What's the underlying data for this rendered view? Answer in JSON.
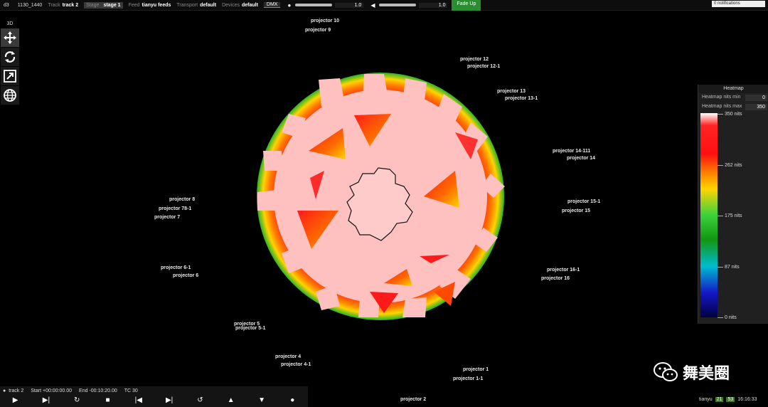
{
  "topbar": {
    "app": "d3",
    "project": "1130_1440",
    "track_label": "Track",
    "track_value": "track 2",
    "stage_label": "Stage",
    "stage_value": "stage 1",
    "feed_label": "Feed",
    "feed_value": "tianyu feeds",
    "transport_label": "Transport",
    "transport_value": "default",
    "devices_label": "Devices",
    "devices_value": "default",
    "dmx": "DMX",
    "brightness_value": "1.0",
    "volume_value": "1.0",
    "fade_label": "Fade Up",
    "notifications": "0 notifications"
  },
  "tools": {
    "mode": "3D",
    "items": [
      "move-icon",
      "rotate-icon",
      "scale-icon",
      "globe-icon"
    ]
  },
  "projectors": [
    "projector 10",
    "projector 9",
    "projector 12",
    "projector 12-1",
    "projector 13",
    "projector 13-1",
    "projector 14-111",
    "projector 14",
    "projector 15-1",
    "projector 15",
    "projector 16-1",
    "projector 16",
    "projector 1",
    "projector 1-1",
    "projector 2",
    "projector 4",
    "projector 4-1",
    "projector 5",
    "projector 5-1",
    "projector 6-1",
    "projector 6",
    "projector 8",
    "projector 78-1",
    "projector 7"
  ],
  "heatmap": {
    "title": "Heatmap",
    "min_label": "Heatmap nits min",
    "min_value": "0",
    "max_label": "Heatmap nits max",
    "max_value": "350",
    "ticks": [
      "350 nits",
      "262 nits",
      "175 nits",
      "87 nits",
      "0 nits"
    ],
    "colors": [
      "#ffffff",
      "#ff2424",
      "#ffd400",
      "#3cd23c",
      "#00bcd0",
      "#1418c8",
      "#000040"
    ]
  },
  "transport": {
    "track": "track 2",
    "start": "Start +00:00:00.00",
    "end": "End -00:10:20.00",
    "tc": "TC 30",
    "buttons": [
      "play-icon",
      "play-to-end-icon",
      "loop-icon",
      "stop-icon",
      "skip-back-icon",
      "skip-forward-icon",
      "return-icon",
      "up-icon",
      "down-icon",
      "record-icon"
    ]
  },
  "status": {
    "user": "tianyu",
    "fps": "21",
    "badge": "53",
    "time": "16:16:33"
  },
  "watermark": "舞美圈",
  "viz": {
    "surface_color": "#ffc0c0",
    "hot_color": "#ff1a1a"
  }
}
